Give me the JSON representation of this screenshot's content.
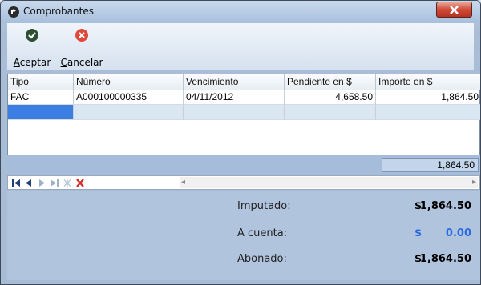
{
  "window": {
    "title": "Comprobantes"
  },
  "toolbar": {
    "accept": {
      "label_u": "A",
      "label_rest": "ceptar"
    },
    "cancel": {
      "label_u": "C",
      "label_rest": "ancelar"
    }
  },
  "grid": {
    "columns": [
      "Tipo",
      "Número",
      "Vencimiento",
      "Pendiente en $",
      "Importe en $"
    ],
    "rows": [
      {
        "tipo": "FAC",
        "numero": "A000100000335",
        "vencimiento": "04/11/2012",
        "pendiente": "4,658.50",
        "importe": "1,864.50"
      }
    ],
    "total": "1,864.50"
  },
  "summary": {
    "imputado_label": "Imputado:",
    "imputado_currency": "$",
    "imputado_value": "1,864.50",
    "acuenta_label": "A cuenta:",
    "acuenta_currency": "$",
    "acuenta_value": "0.00",
    "abonado_label": "Abonado:",
    "abonado_currency": "$",
    "abonado_value": "1,864.50"
  },
  "colors": {
    "accent_blue": "#2a6be0",
    "selection": "#3b7de0",
    "close_red": "#cf4a36"
  }
}
